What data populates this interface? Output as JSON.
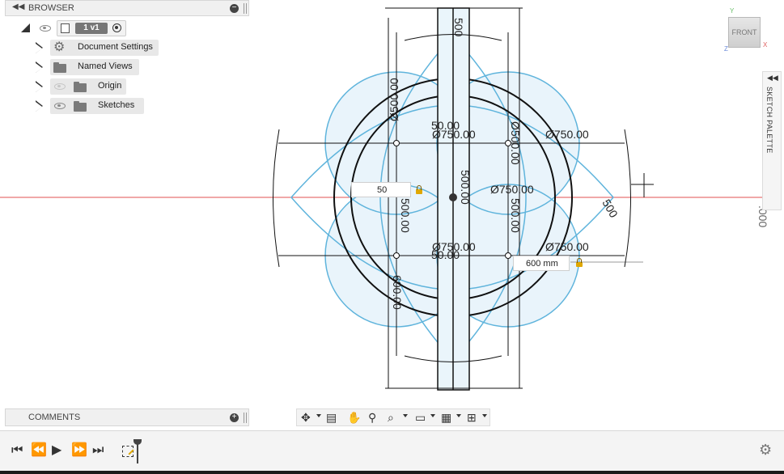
{
  "browser": {
    "title": "BROWSER",
    "root_label": "1 v1",
    "items": [
      {
        "label": "Document Settings",
        "icon": "gear-icon"
      },
      {
        "label": "Named Views",
        "icon": "folder-icon"
      },
      {
        "label": "Origin",
        "icon": "folder-icon"
      },
      {
        "label": "Sketches",
        "icon": "folder-icon"
      }
    ]
  },
  "comments": {
    "title": "COMMENTS"
  },
  "palette": {
    "title": "SKETCH PALETTE"
  },
  "viewcube": {
    "face": "FRONT",
    "axis_y": "Y",
    "axis_z": "Z",
    "axis_x": "X"
  },
  "sketch": {
    "dims": {
      "diam_top_left": "Ø750.00",
      "diam_top_right": "Ø750.00",
      "diam_mid": "Ø750.00",
      "diam_bot_left": "Ø750.00",
      "diam_bot_right": "Ø750.00",
      "fifty_top": "50.00",
      "fifty_bot": "50.00",
      "top_small": "500",
      "right_small": "500",
      "vert_a": "Ø500.00",
      "vert_b": "Ø500.00",
      "vert_c": "500.00",
      "vert_d": "500.00",
      "vert_e": "500.00",
      "vert_f": "600.00",
      "vert_g": "500.00",
      "far_right": ".000"
    },
    "input_left": "50",
    "input_right": "600 mm"
  },
  "colors": {
    "sketch_blue": "#5fb4dc",
    "sketch_black": "#111111",
    "axis_red": "#e05050",
    "lock": "#e0a800"
  }
}
